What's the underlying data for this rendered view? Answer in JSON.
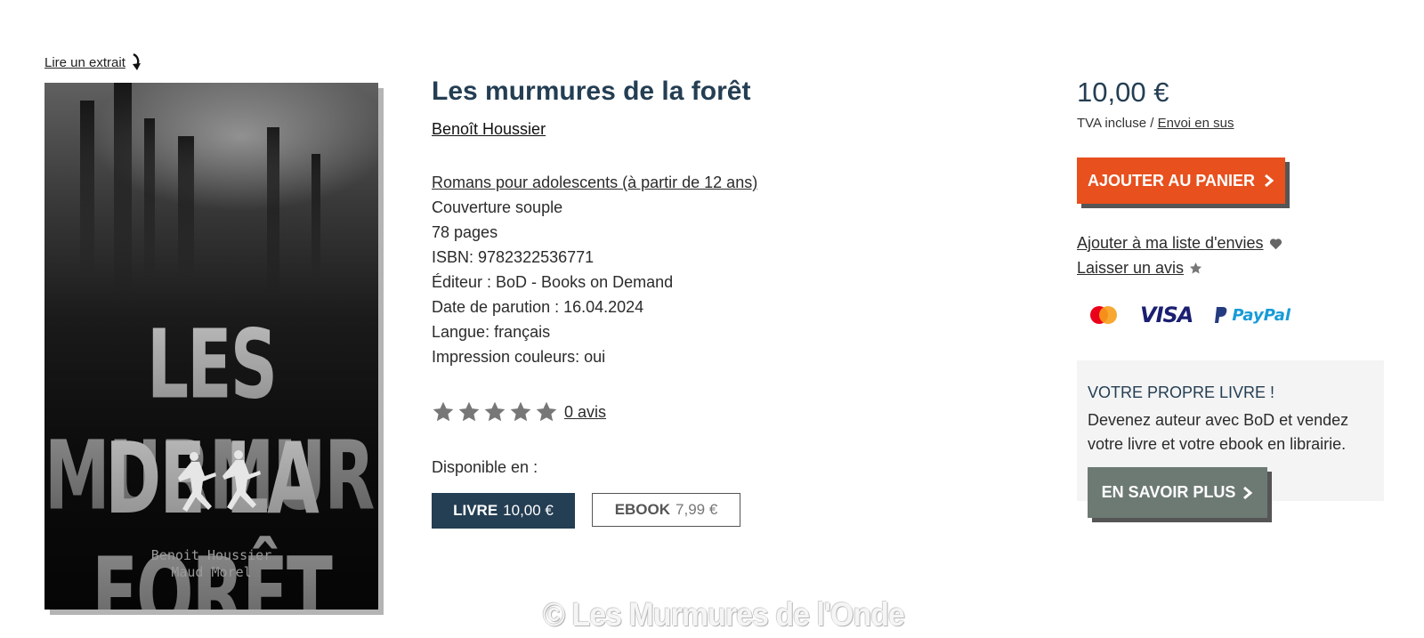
{
  "excerpt_link": "Lire un extrait",
  "cover": {
    "title_line1": "LES MURMURES",
    "title_line2": "DE LA FORÊT",
    "author1": "Benoit Houssier",
    "author2": "Maud Morel"
  },
  "product": {
    "title": "Les murmures de la forêt",
    "author": "Benoît Houssier",
    "category": "Romans pour adolescents (à partir de 12 ans)",
    "binding": "Couverture souple",
    "pages": "78 pages",
    "isbn": "ISBN: 9782322536771",
    "publisher": "Éditeur : BoD - Books on Demand",
    "date": "Date de parution : 16.04.2024",
    "language": "Langue: français",
    "color_print": "Impression couleurs: oui"
  },
  "rating": {
    "stars": 5,
    "value": 0,
    "reviews_link": "0 avis"
  },
  "availability": {
    "label": "Disponible en :",
    "formats": [
      {
        "name": "LIVRE",
        "price": "10,00 €",
        "selected": true
      },
      {
        "name": "EBOOK",
        "price": "7,99 €",
        "selected": false
      }
    ]
  },
  "purchase": {
    "price": "10,00 €",
    "tax_text": "TVA incluse / ",
    "shipping_link": "Envoi en sus",
    "add_to_cart": "AJOUTER AU PANIER",
    "wishlist_link": "Ajouter à ma liste d'envies",
    "review_link": "Laisser un avis",
    "payment_visa": "VISA",
    "payment_paypal": "PayPal"
  },
  "promo": {
    "title": "VOTRE PROPRE LIVRE !",
    "text": "Devenez auteur avec BoD et vendez votre livre et votre ebook en librairie.",
    "button": "EN SAVOIR PLUS"
  },
  "watermark": "© Les Murmures de l'Onde",
  "colors": {
    "title": "#243e53",
    "cart_button": "#e8501e",
    "selected_format": "#243e53",
    "promo_button": "#6d7a73"
  }
}
